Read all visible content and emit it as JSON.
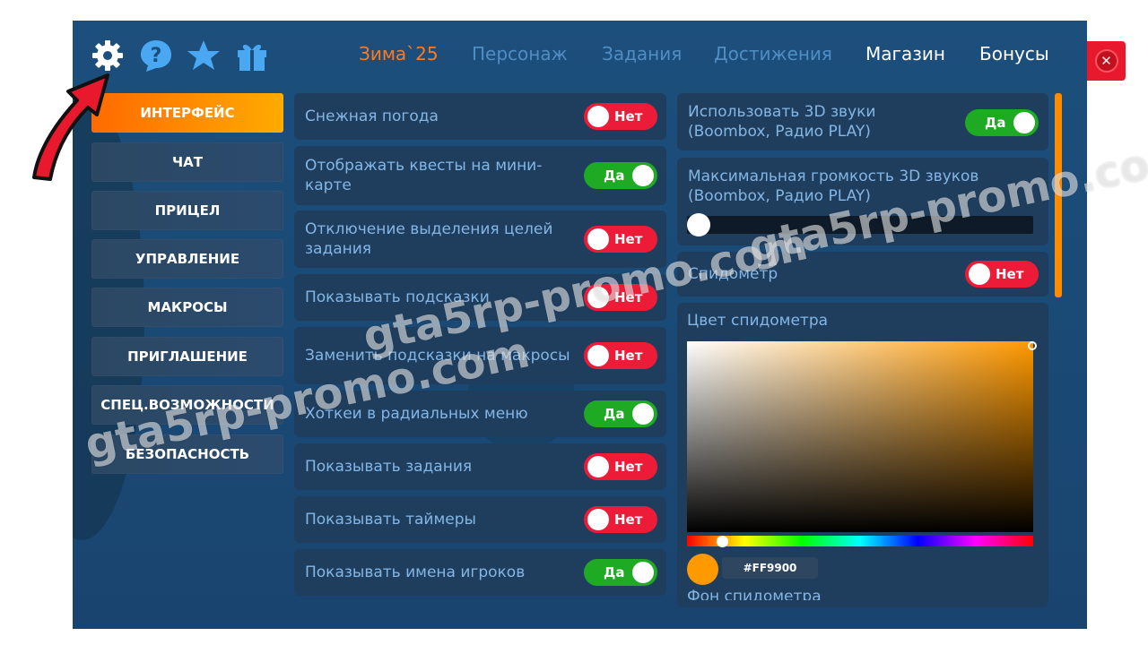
{
  "colors": {
    "accent": "#ff8c00",
    "toggle_on": "#1faa24",
    "toggle_off": "#ec1c38",
    "panel": "#1f3e5e",
    "background": "#1d4f7c",
    "selected_color": "#ff9900"
  },
  "top_icons": [
    "gear-icon",
    "help-icon",
    "star-icon",
    "gift-icon"
  ],
  "tabs": [
    {
      "label": "Зима`25"
    },
    {
      "label": "Персонаж"
    },
    {
      "label": "Задания"
    },
    {
      "label": "Достижения"
    },
    {
      "label": "Магазин"
    },
    {
      "label": "Бонусы"
    }
  ],
  "sidebar": {
    "items": [
      {
        "label": "ИНТЕРФЕЙС"
      },
      {
        "label": "ЧАТ"
      },
      {
        "label": "ПРИЦЕЛ"
      },
      {
        "label": "УПРАВЛЕНИЕ"
      },
      {
        "label": "МАКРОСЫ"
      },
      {
        "label": "ПРИГЛАШЕНИЕ"
      },
      {
        "label": "СПЕЦ.ВОЗМОЖНОСТИ"
      },
      {
        "label": "БЕЗОПАСНОСТЬ"
      }
    ]
  },
  "settings_left": [
    {
      "label": "Снежная погода",
      "state": "Нет"
    },
    {
      "label": "Отображать квесты на мини-карте",
      "state": "Да"
    },
    {
      "label": "Отключение выделения целей задания",
      "state": "Нет"
    },
    {
      "label": "Показывать подсказки",
      "state": "Нет"
    },
    {
      "label": "Заменить подсказки на макросы",
      "state": "Нет"
    },
    {
      "label": "Хоткеи в радиальных меню",
      "state": "Да"
    },
    {
      "label": "Показывать задания",
      "state": "Нет"
    },
    {
      "label": "Показывать таймеры",
      "state": "Нет"
    },
    {
      "label": "Показывать имена игроков",
      "state": "Да"
    }
  ],
  "settings_right": {
    "sound3d": {
      "label": "Использовать 3D звуки (Boombox, Радио PLAY)",
      "state": "Да"
    },
    "volume": {
      "label": "Максимальная громкость 3D звуков (Boombox, Радио PLAY)",
      "value": 0
    },
    "speedometer": {
      "label": "Спидометр",
      "state": "Нет"
    },
    "speedometer_color": {
      "label": "Цвет спидометра",
      "hex": "#FF9900"
    },
    "speedometer_bg": {
      "label": "Фон спидометра"
    }
  },
  "watermark": "gta5rp-promo.com"
}
